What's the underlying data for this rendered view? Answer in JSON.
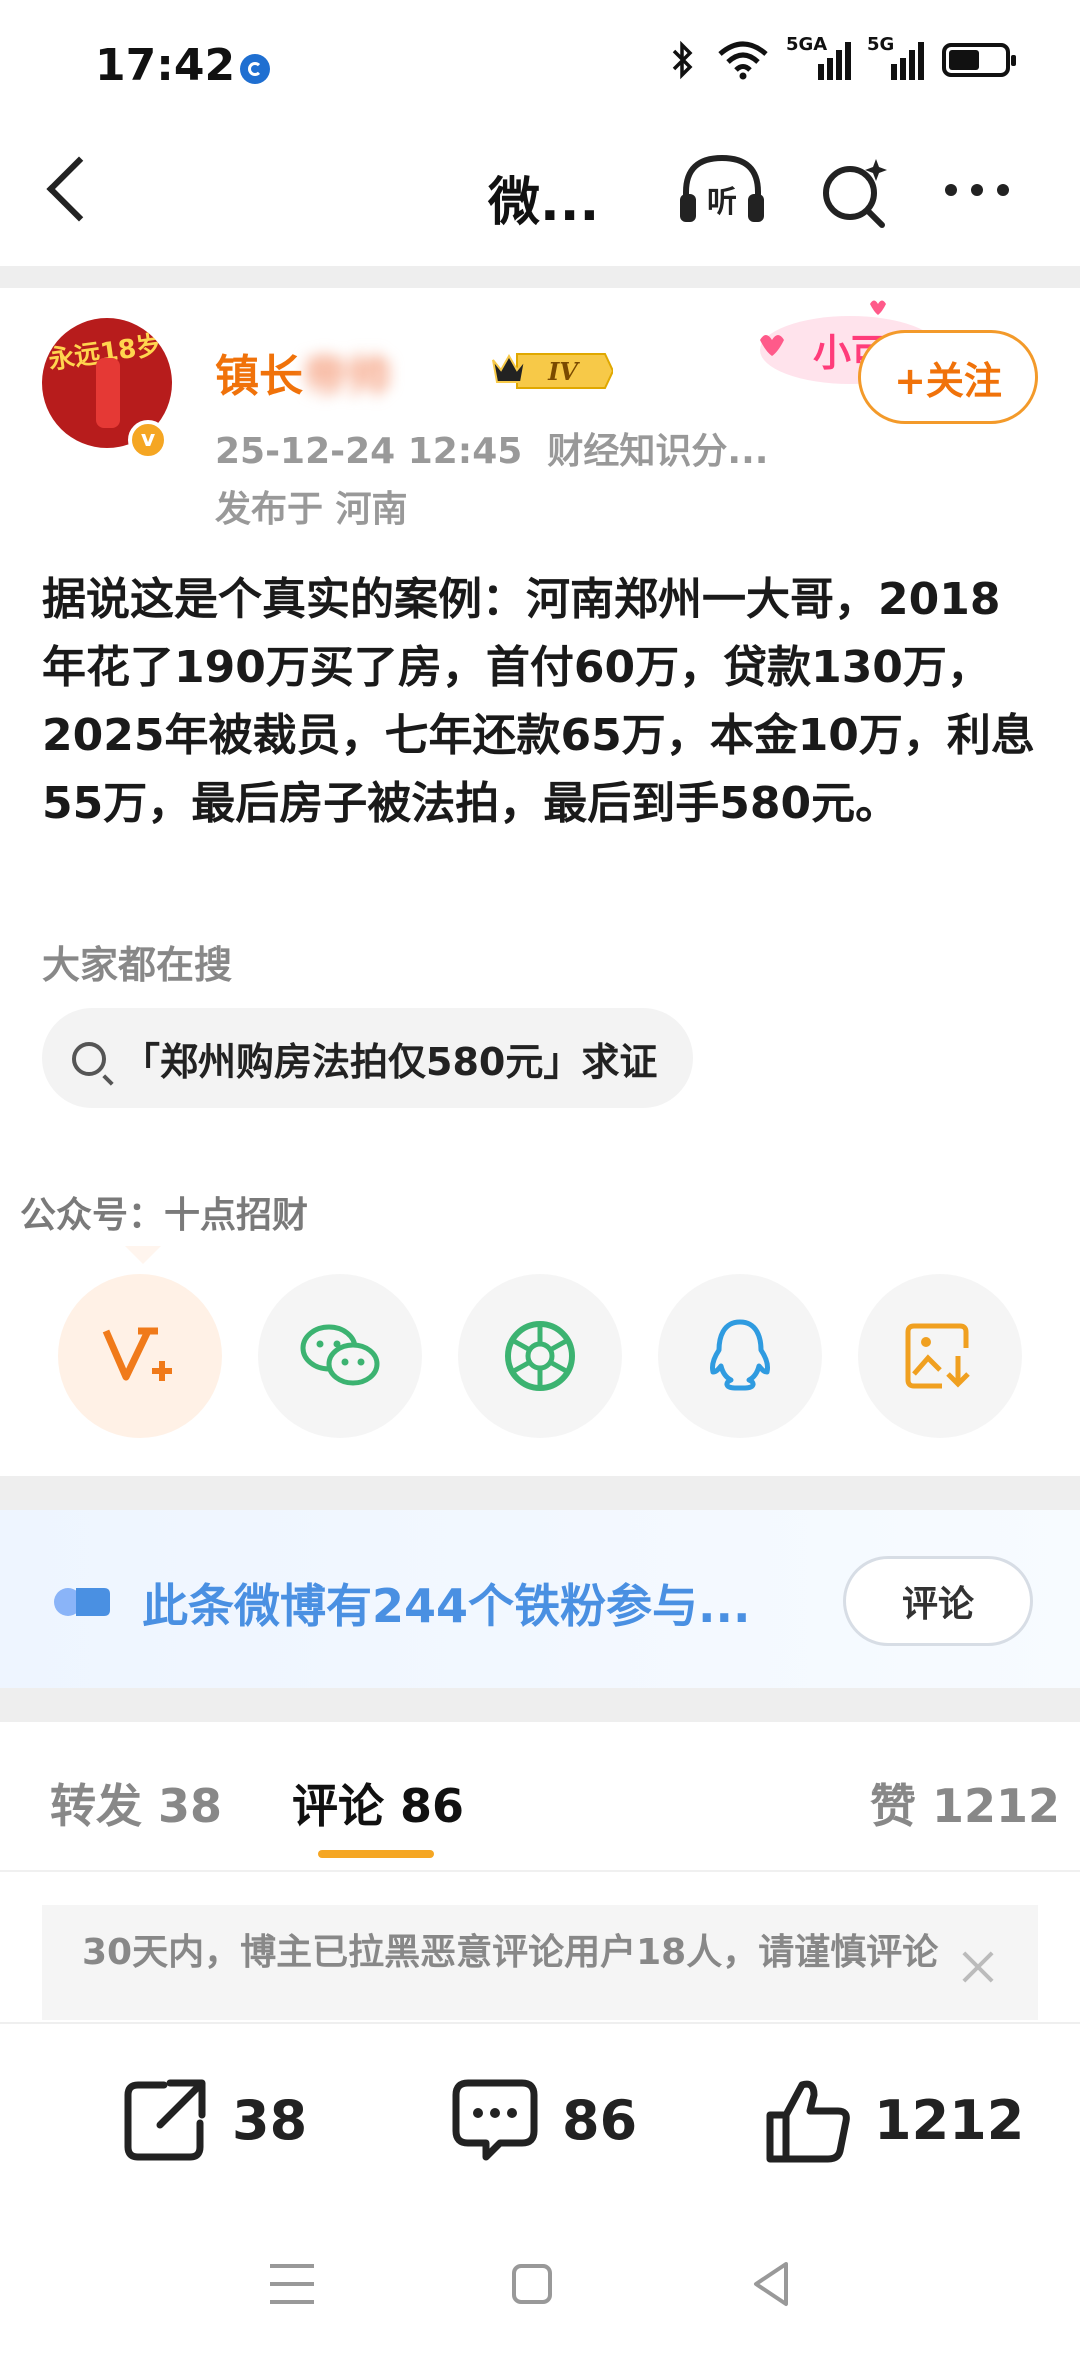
{
  "status_bar": {
    "time": "17:42",
    "net1": "5GA",
    "net2": "5G",
    "battery_level": 0.55
  },
  "header": {
    "title": "微...",
    "listen_label": "听"
  },
  "post": {
    "username_visible": "镇长",
    "username_blurred": "帝帅",
    "level": "IV",
    "follow_label": "+关注",
    "timestamp": "25-12-24 12:45",
    "source": "财经知识分...",
    "location": "发布于 河南",
    "text": "据说这是个真实的案例：河南郑州一大哥，2018年花了190万买了房，首付60万，贷款130万，2025年被裁员，七年还款65万，本金10万，利息55万，最后房子被法拍，最后到手580元。",
    "deco_text": "小可爱",
    "avatar_text": "永远18岁"
  },
  "hot_search": {
    "title": "大家都在搜",
    "query": "「郑州购房法拍仅580元」求证"
  },
  "wechat_account": "公众号：十点招财",
  "share_targets": [
    "weibo-v-plus-icon",
    "wechat-icon",
    "moments-icon",
    "qq-icon",
    "save-image-icon"
  ],
  "fans": {
    "text": "此条微博有244个铁粉参与...",
    "button": "评论"
  },
  "tabs": {
    "repost": "转发 38",
    "comment": "评论 86",
    "like": "赞 1212"
  },
  "notice": "30天内，博主已拉黑恶意评论用户18人，请谨慎评论",
  "actions": {
    "repost_count": "38",
    "comment_count": "86",
    "like_count": "1212"
  },
  "colors": {
    "accent": "#f0720a",
    "tab_underline": "#f5a623",
    "link_blue": "#4a90e2"
  }
}
